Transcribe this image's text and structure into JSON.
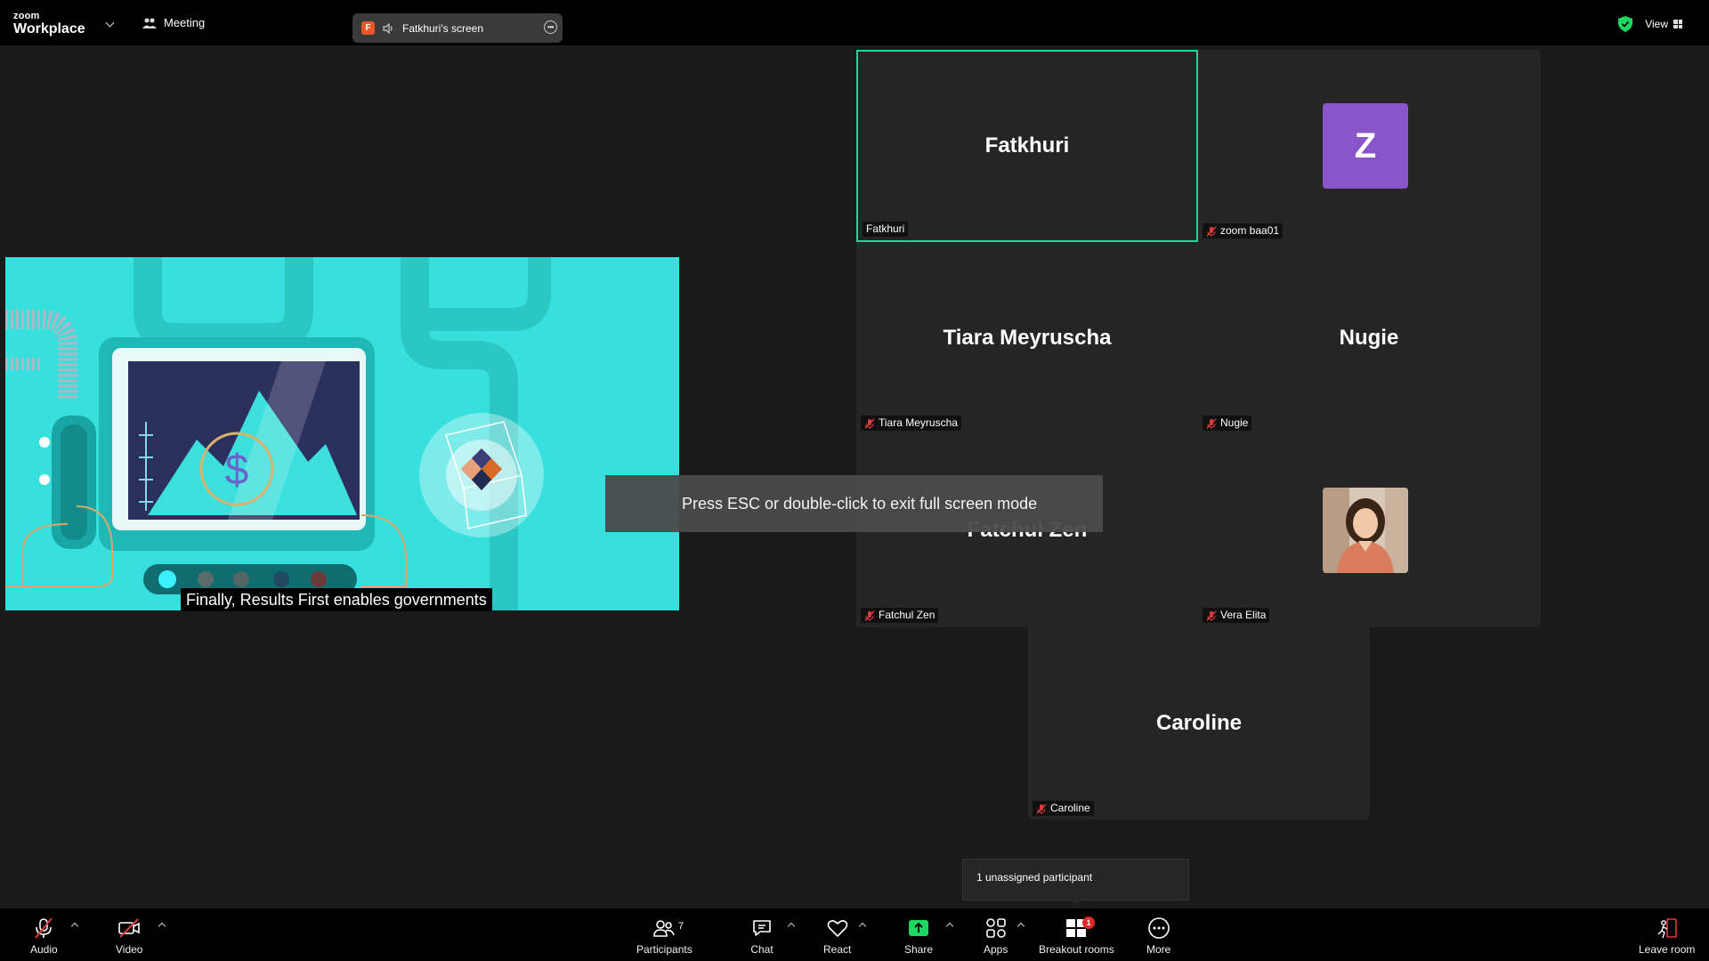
{
  "app": {
    "logo_top": "zoom",
    "logo_bottom": "Workplace",
    "meeting_label": "Meeting",
    "screen_share_initial": "F",
    "screen_share_label": "Fatkhuri's screen",
    "view_label": "View"
  },
  "share": {
    "caption": "Finally, Results First enables governments",
    "currency_symbol": "$"
  },
  "toast": "Press ESC or double-click to exit full screen mode",
  "tiles": [
    {
      "display": "Fatkhuri",
      "label": "Fatkhuri",
      "muted": false,
      "active": true
    },
    {
      "display": "Z",
      "label": "zoom baa01",
      "muted": true
    },
    {
      "display": "Tiara Meyruscha",
      "label": "Tiara Meyruscha",
      "muted": true
    },
    {
      "display": "Nugie",
      "label": "Nugie",
      "muted": true
    },
    {
      "display": "Fatchul Zen",
      "label": "Fatchul Zen",
      "muted": true
    },
    {
      "display": "",
      "label": "Vera Elita",
      "muted": true
    },
    {
      "display": "Caroline",
      "label": "Caroline",
      "muted": true
    }
  ],
  "unassigned": "1 unassigned participant",
  "toolbar": {
    "audio": "Audio",
    "video": "Video",
    "participants": "Participants",
    "participants_count": "7",
    "chat": "Chat",
    "react": "React",
    "share": "Share",
    "apps": "Apps",
    "breakout": "Breakout rooms",
    "breakout_badge": "1",
    "more": "More",
    "leave": "Leave room"
  },
  "colors": {
    "active_border": "#1ed796",
    "share_bg": "#38e0dd",
    "avatar_z": "#8a55c9",
    "share_button": "#1ed760",
    "muted_icon": "#e03a3a"
  }
}
